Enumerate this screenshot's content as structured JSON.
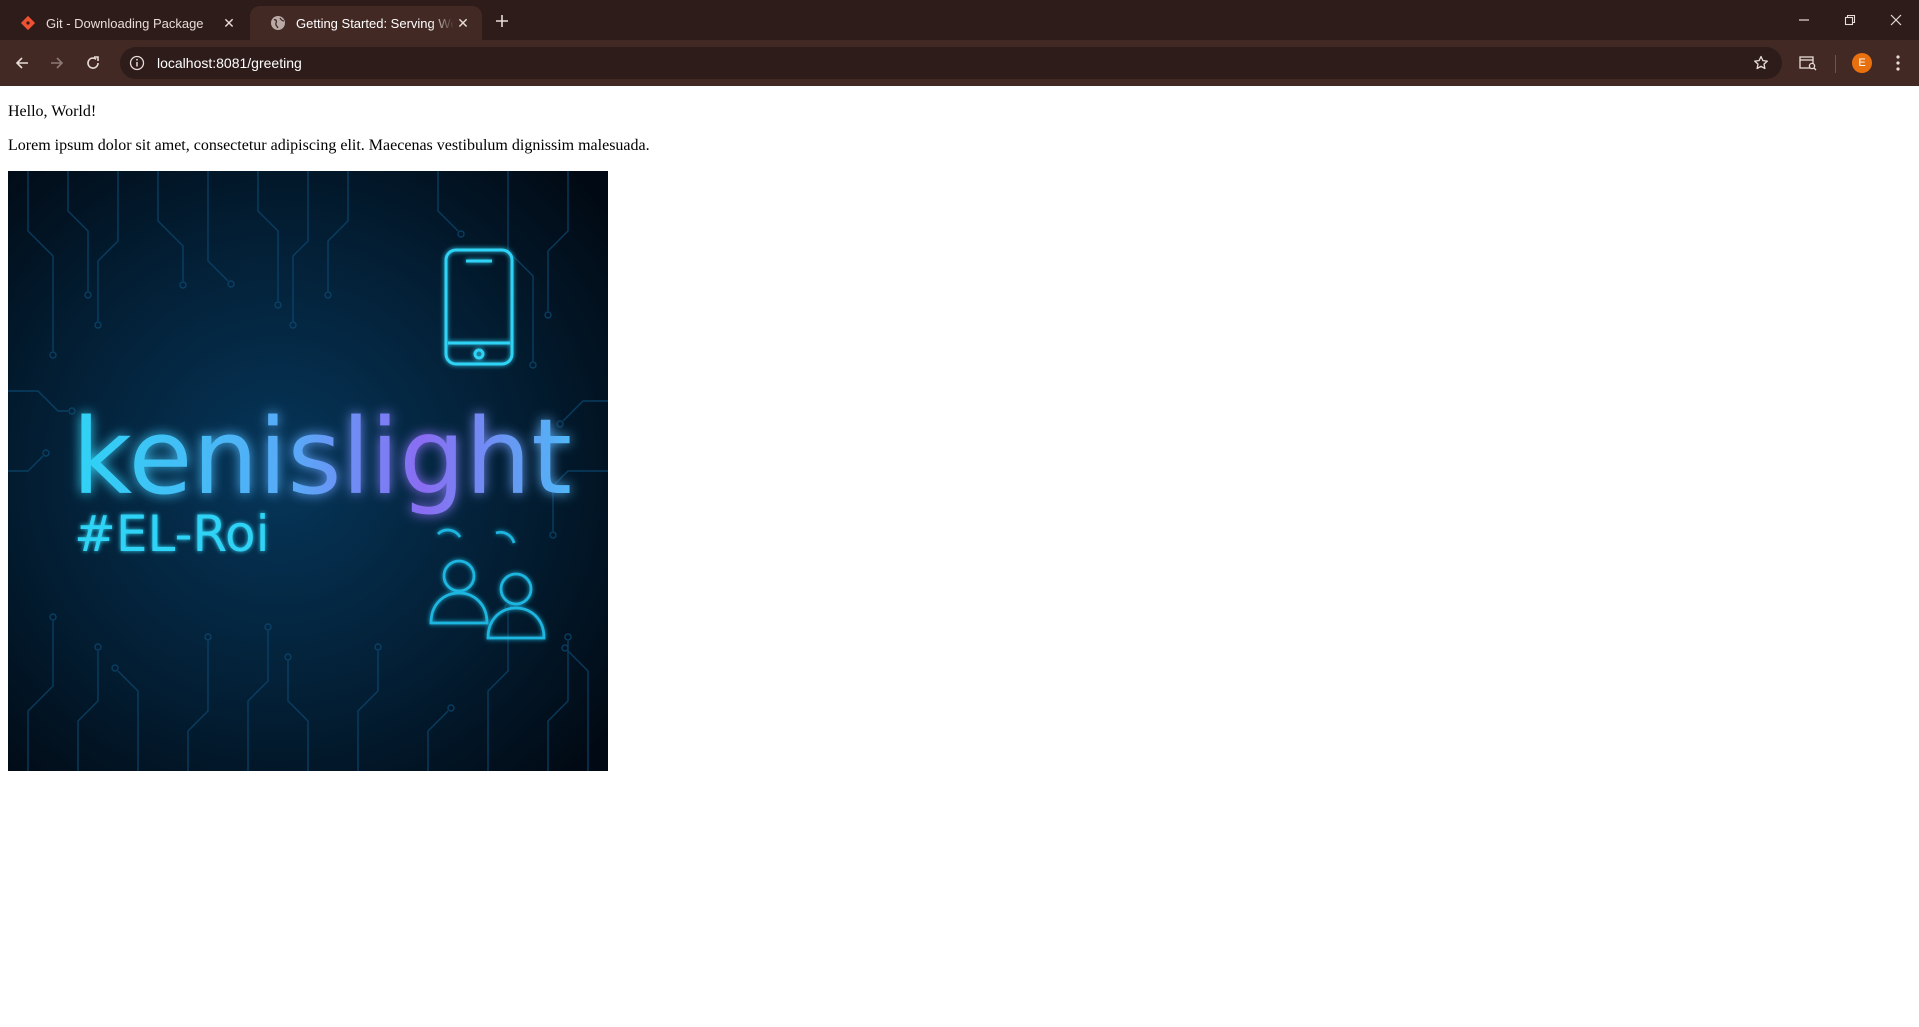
{
  "browser": {
    "tabs": [
      {
        "title": "Git - Downloading Package",
        "active": false,
        "favicon": "git-logo-icon"
      },
      {
        "title": "Getting Started: Serving Web Content",
        "active": true,
        "favicon": "globe-icon"
      }
    ],
    "address": {
      "url": "localhost:8081/greeting"
    },
    "profile_initial": "E",
    "colors": {
      "frame": "#2d1c19",
      "toolbar": "#432924",
      "avatar": "#e8700e"
    }
  },
  "page": {
    "greeting": "Hello, World!",
    "paragraph": "Lorem ipsum dolor sit amet, consectetur adipiscing elit. Maecenas vestibulum dignissim malesuada.",
    "image": {
      "logo_text": "kenislight",
      "hashtag": "#EL-Roi",
      "icons": [
        "smartphone-icon",
        "people-icon"
      ],
      "colors": {
        "background": "#021a2b",
        "neon_cyan": "#2ed3f5",
        "neon_purple": "#8a6cf2"
      }
    }
  }
}
